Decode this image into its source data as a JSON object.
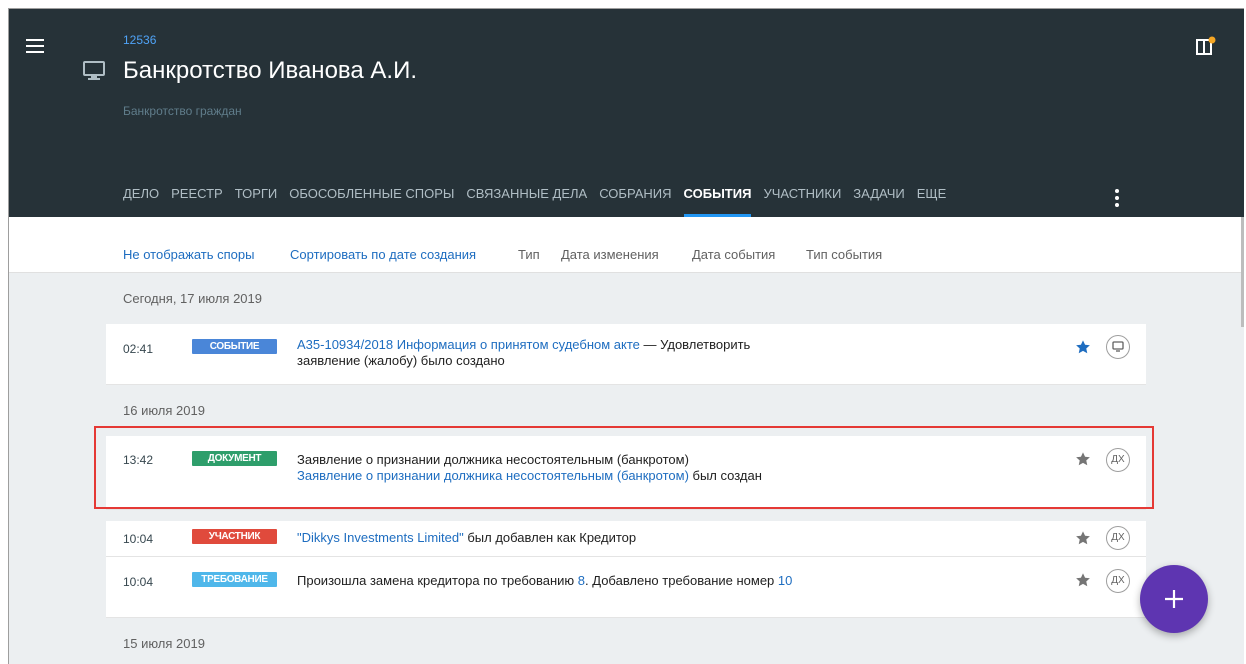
{
  "case": {
    "number": "12536",
    "title": "Банкротство Иванова А.И.",
    "subtitle": "Банкротство граждан"
  },
  "tabs": [
    "ДЕЛО",
    "РЕЕСТР",
    "ТОРГИ",
    "ОБОСОБЛЕННЫЕ СПОРЫ",
    "СВЯЗАННЫЕ ДЕЛА",
    "СОБРАНИЯ",
    "СОБЫТИЯ",
    "УЧАСТНИКИ",
    "ЗАДАЧИ",
    "ЕЩЕ"
  ],
  "active_tab": "СОБЫТИЯ",
  "filters": {
    "hide_disputes": "Не отображать споры",
    "sort_by_created": "Сортировать по дате создания",
    "type": "Тип",
    "changed_date": "Дата изменения",
    "event_date": "Дата события",
    "event_type": "Тип события"
  },
  "groups": [
    {
      "date": "Сегодня, 17 июля 2019"
    },
    {
      "date": "16 июля 2019"
    },
    {
      "date": "15 июля 2019"
    }
  ],
  "events": [
    {
      "time": "02:41",
      "badge": "СОБЫТИЕ",
      "badge_color": "#4a86d8",
      "link": "А35-10934/2018 Информация о принятом судебном акте",
      "text": " — Удовлетворить заявление (жалобу) было создано",
      "action": "monitor-icon",
      "star_color": "#1e6dc0"
    },
    {
      "time": "13:42",
      "badge": "ДОКУМЕНТ",
      "badge_color": "#2e9e6b",
      "text_pre": "Заявление о признании должника несостоятельным (банкротом)",
      "link": "Заявление о признании должника несостоятельным (банкротом)",
      "text": " был создан",
      "action": "ДХ",
      "star_color": "#757575"
    },
    {
      "time": "10:04",
      "badge": "УЧАСТНИК",
      "badge_color": "#e04a3c",
      "link": "\"Dikkys Investments Limited\"",
      "text": " был добавлен как Кредитор",
      "action": "ДХ",
      "star_color": "#757575"
    },
    {
      "time": "10:04",
      "badge": "ТРЕБОВАНИЕ",
      "badge_color": "#4fb7ea",
      "text_pre": "Произошла замена кредитора по требованию ",
      "link": "8",
      "text": ". Добавлено требование номер ",
      "link2": "10",
      "action": "ДХ",
      "star_color": "#757575"
    }
  ],
  "fab": {
    "icon": "plus-icon",
    "color": "#5e35b1"
  }
}
